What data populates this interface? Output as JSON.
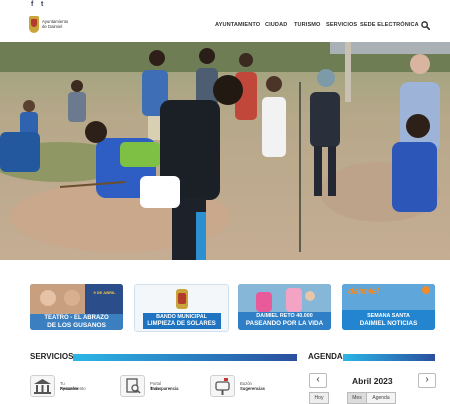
{
  "social": {
    "facebook": "f",
    "twitter": "t"
  },
  "logo": {
    "text": "Ayuntamiento de Daimiel"
  },
  "nav": {
    "items": [
      "AYUNTAMIENTO",
      "CIUDAD",
      "TURISMO",
      "SERVICIOS",
      "SEDE ELECTRÓNICA"
    ]
  },
  "tiles": [
    {
      "small": "9 DE ABRIL",
      "line1": "TEATRO - EL ABRAZO",
      "line2": "DE LOS GUSANOS"
    },
    {
      "line1": "BANDO MUNICIPAL",
      "line2": "LIMPIEZA DE SOLARES"
    },
    {
      "line1": "DAIMIEL RETO 40.000",
      "line2": "PASEANDO POR LA VIDA"
    },
    {
      "logo": "daimiel",
      "line1": "SEMANA SANTA",
      "line2": "DAIMIEL NOTICIAS"
    }
  ],
  "services": {
    "title": "SERVICIOS",
    "items": [
      {
        "label1": "Tu Ayuntamiento",
        "label2": "Resuelve"
      },
      {
        "label1": "Portal de la",
        "label2": "Transparencia"
      },
      {
        "label1": "Buzón",
        "label2": "Sugerencias"
      }
    ]
  },
  "agenda": {
    "title": "AGENDA",
    "month": "Abril 2023",
    "prev": "‹",
    "next": "›",
    "btn_today": "Hoy",
    "btn_month": "Mes",
    "btn_agenda": "Agenda"
  },
  "colors": {
    "accent": "#1c8fce",
    "accent_dark": "#2a4f9e",
    "nav_text": "#333333"
  }
}
